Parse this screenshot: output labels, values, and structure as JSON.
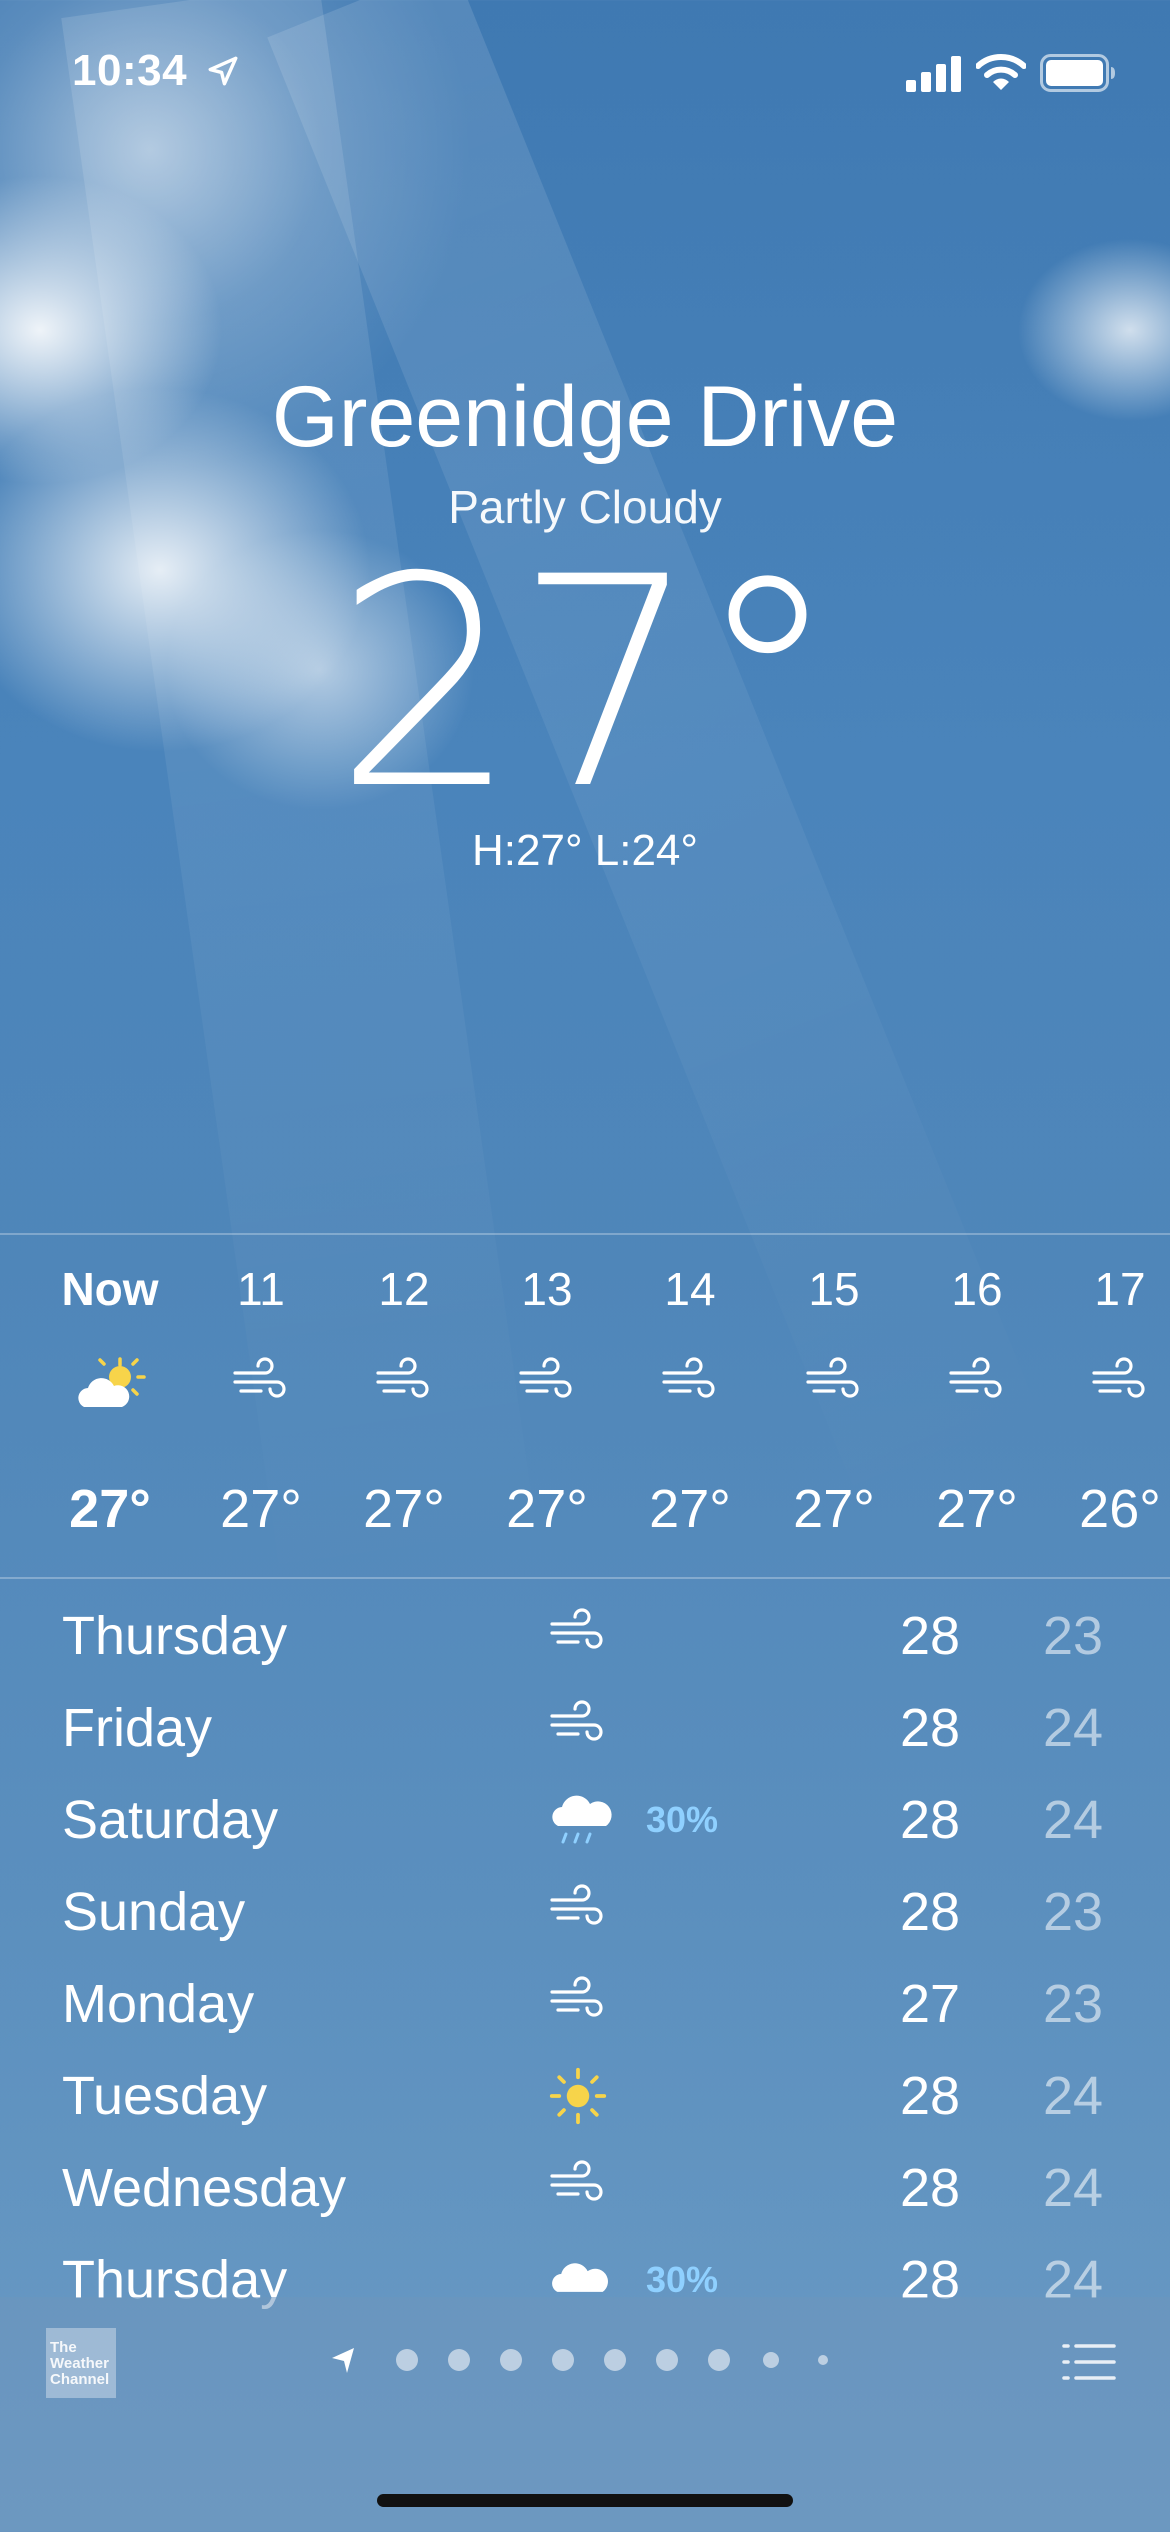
{
  "status_bar": {
    "time": "10:34"
  },
  "location": {
    "name": "Greenidge Drive",
    "condition": "Partly Cloudy",
    "temperature": "27°",
    "high_low": "H:27°  L:24°"
  },
  "hourly": [
    {
      "label": "Now",
      "icon": "partly-cloudy-icon",
      "temp": "27°"
    },
    {
      "label": "11",
      "icon": "wind-icon",
      "temp": "27°"
    },
    {
      "label": "12",
      "icon": "wind-icon",
      "temp": "27°"
    },
    {
      "label": "13",
      "icon": "wind-icon",
      "temp": "27°"
    },
    {
      "label": "14",
      "icon": "wind-icon",
      "temp": "27°"
    },
    {
      "label": "15",
      "icon": "wind-icon",
      "temp": "27°"
    },
    {
      "label": "16",
      "icon": "wind-icon",
      "temp": "27°"
    },
    {
      "label": "17",
      "icon": "wind-icon",
      "temp": "26°"
    }
  ],
  "daily": [
    {
      "day": "Thursday",
      "icon": "wind-icon",
      "precip": "",
      "high": "28",
      "low": "23"
    },
    {
      "day": "Friday",
      "icon": "wind-icon",
      "precip": "",
      "high": "28",
      "low": "24"
    },
    {
      "day": "Saturday",
      "icon": "rain-icon",
      "precip": "30%",
      "high": "28",
      "low": "24"
    },
    {
      "day": "Sunday",
      "icon": "wind-icon",
      "precip": "",
      "high": "28",
      "low": "23"
    },
    {
      "day": "Monday",
      "icon": "wind-icon",
      "precip": "",
      "high": "27",
      "low": "23"
    },
    {
      "day": "Tuesday",
      "icon": "sun-icon",
      "precip": "",
      "high": "28",
      "low": "24"
    },
    {
      "day": "Wednesday",
      "icon": "wind-icon",
      "precip": "",
      "high": "28",
      "low": "24"
    },
    {
      "day": "Thursday",
      "icon": "cloud-icon",
      "precip": "30%",
      "high": "28",
      "low": "24"
    }
  ],
  "footer": {
    "provider": "The Weather Channel",
    "page_count": 9,
    "active_page": 0
  },
  "colors": {
    "sun": "#f7d44a",
    "precip": "#8fd0ff"
  }
}
